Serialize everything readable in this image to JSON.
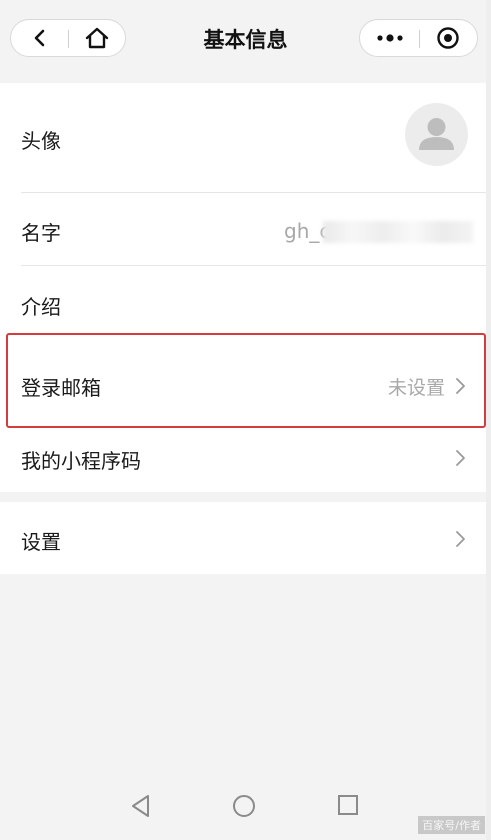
{
  "nav": {
    "title": "基本信息",
    "back_icon": "chevron-left-icon",
    "home_icon": "home-icon",
    "more_icon": "more-dots-icon",
    "close_icon": "target-close-icon"
  },
  "rows": {
    "avatar": {
      "label": "头像",
      "icon": "avatar-placeholder-icon"
    },
    "name": {
      "label": "名字",
      "value": "gh_c"
    },
    "intro": {
      "label": "介绍"
    },
    "email": {
      "label": "登录邮箱",
      "value": "未设置"
    },
    "qrcode": {
      "label": "我的小程序码"
    },
    "settings": {
      "label": "设置"
    }
  },
  "system_nav": {
    "back": "triangle-back-icon",
    "home": "circle-home-icon",
    "recents": "square-recents-icon"
  },
  "watermark": "百家号/作者",
  "colors": {
    "highlight": "#d43d3d",
    "background": "#f3f3f3",
    "muted_text": "#a8a8a8"
  }
}
